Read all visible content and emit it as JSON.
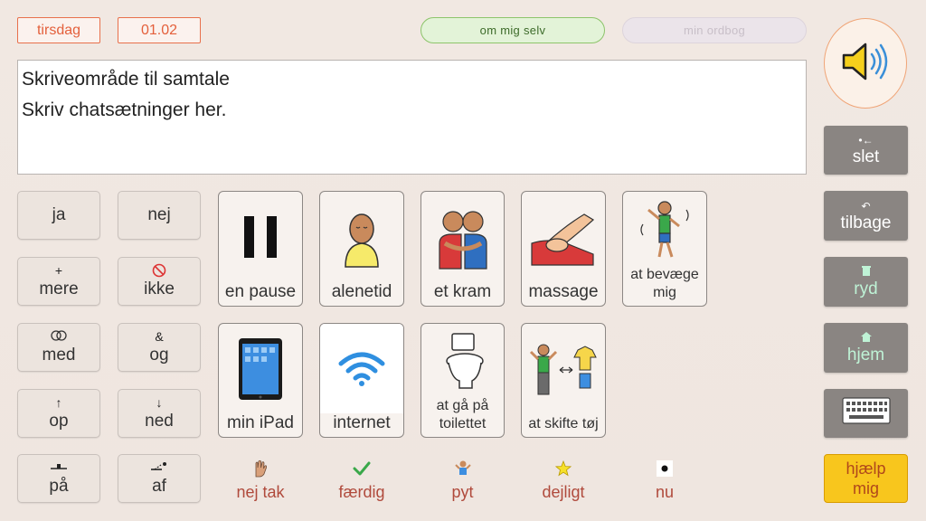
{
  "header": {
    "day": "tirsdag",
    "date": "01.02",
    "about_me": "om mig selv",
    "dictionary": "min ordbog"
  },
  "writing_area": {
    "line1": "Skriveområde til samtale",
    "line2": "Skriv chatsætninger her."
  },
  "small_buttons": [
    {
      "label": "ja",
      "icon": ""
    },
    {
      "label": "nej",
      "icon": ""
    },
    {
      "label": "mere",
      "icon": "+"
    },
    {
      "label": "ikke",
      "icon": "⃠"
    },
    {
      "label": "med",
      "icon": "oo"
    },
    {
      "label": "og",
      "icon": "&"
    },
    {
      "label": "op",
      "icon": "↑"
    },
    {
      "label": "ned",
      "icon": "↓"
    },
    {
      "label": "på",
      "icon": "⊥"
    },
    {
      "label": "af",
      "icon": "↗"
    }
  ],
  "cards_row1": [
    {
      "label": "en pause"
    },
    {
      "label": "alenetid"
    },
    {
      "label": "et kram"
    },
    {
      "label": "massage"
    },
    {
      "label": "at bevæge mig"
    }
  ],
  "cards_row2": [
    {
      "label": "min iPad"
    },
    {
      "label": "internet"
    },
    {
      "label": "at gå på toilettet"
    },
    {
      "label": "at skifte tøj"
    }
  ],
  "quick_words": [
    {
      "label": "nej tak",
      "icon": "hand-stop-icon"
    },
    {
      "label": "færdig",
      "icon": "checkmark-icon"
    },
    {
      "label": "pyt",
      "icon": "shrug-person-icon"
    },
    {
      "label": "dejligt",
      "icon": "star-icon"
    },
    {
      "label": "nu",
      "icon": "dot-icon"
    }
  ],
  "right_panel": {
    "delete": "slet",
    "back": "tilbage",
    "clear": "ryd",
    "home": "hjem",
    "help_line1": "hjælp",
    "help_line2": "mig"
  },
  "colors": {
    "accent_orange": "#e4603c",
    "help_yellow": "#f8c61d",
    "quickword_red": "#b04a3c",
    "panel_grey": "#8a8582"
  }
}
